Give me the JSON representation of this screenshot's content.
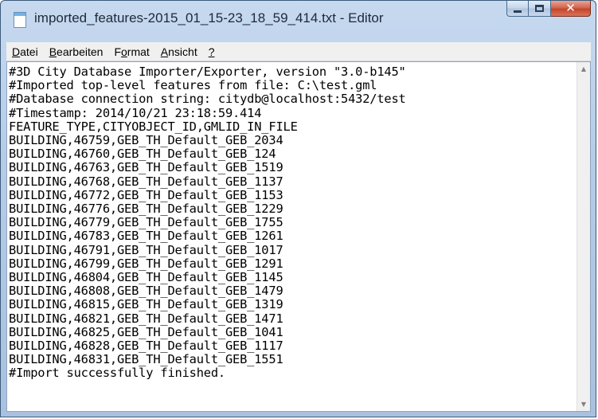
{
  "window": {
    "title": "imported_features-2015_01_15-23_18_59_414.txt - Editor",
    "buttons": {
      "minimize": "minimize",
      "maximize": "maximize",
      "close": "✕"
    }
  },
  "menu": {
    "items": [
      {
        "label": "atei",
        "accel": "D"
      },
      {
        "label": "earbeiten",
        "accel": "B"
      },
      {
        "label": "rmat",
        "accel": "o",
        "prefix": "F"
      },
      {
        "label": "nsicht",
        "accel": "A"
      },
      {
        "label": "",
        "accel": "?"
      }
    ]
  },
  "document": {
    "lines": [
      "#3D City Database Importer/Exporter, version \"3.0-b145\"",
      "#Imported top-level features from file: C:\\test.gml",
      "#Database connection string: citydb@localhost:5432/test",
      "#Timestamp: 2014/10/21 23:18:59.414",
      "FEATURE_TYPE,CITYOBJECT_ID,GMLID_IN_FILE",
      "BUILDING,46759,GEB_TH_Default_GEB_2034",
      "BUILDING,46760,GEB_TH_Default_GEB_124",
      "BUILDING,46763,GEB_TH_Default_GEB_1519",
      "BUILDING,46768,GEB_TH_Default_GEB_1137",
      "BUILDING,46772,GEB_TH_Default_GEB_1153",
      "BUILDING,46776,GEB_TH_Default_GEB_1229",
      "BUILDING,46779,GEB_TH_Default_GEB_1755",
      "BUILDING,46783,GEB_TH_Default_GEB_1261",
      "BUILDING,46791,GEB_TH_Default_GEB_1017",
      "BUILDING,46799,GEB_TH_Default_GEB_1291",
      "BUILDING,46804,GEB_TH_Default_GEB_1145",
      "BUILDING,46808,GEB_TH_Default_GEB_1479",
      "BUILDING,46815,GEB_TH_Default_GEB_1319",
      "BUILDING,46821,GEB_TH_Default_GEB_1471",
      "BUILDING,46825,GEB_TH_Default_GEB_1041",
      "BUILDING,46828,GEB_TH_Default_GEB_1117",
      "BUILDING,46831,GEB_TH_Default_GEB_1551",
      "#Import successfully finished."
    ]
  },
  "scrollbar": {
    "up_arrow": "▲",
    "down_arrow": "▼"
  },
  "colors": {
    "title_bar": "#b5cbe6",
    "close_button": "#c4452b"
  }
}
